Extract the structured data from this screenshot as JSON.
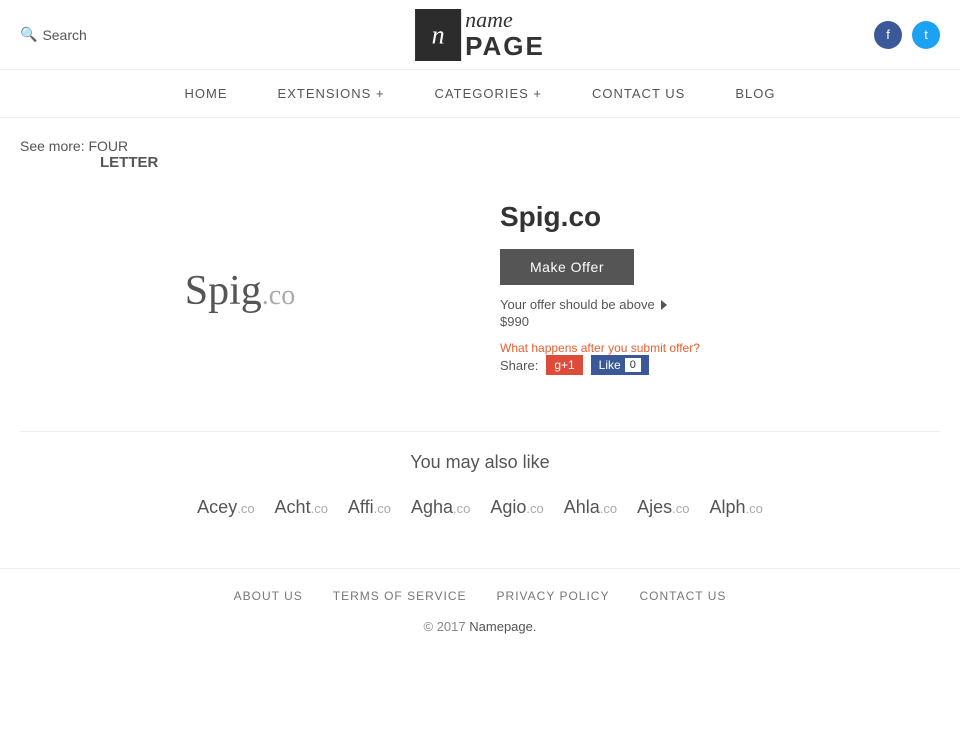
{
  "header": {
    "search_label": "Search",
    "logo_icon_char": "n",
    "logo_name": "name",
    "logo_page": "PAGE",
    "social": {
      "facebook_char": "f",
      "twitter_char": "t"
    }
  },
  "nav": {
    "items": [
      {
        "label": "HOME",
        "key": "home"
      },
      {
        "label": "EXTENSIONS +",
        "key": "extensions"
      },
      {
        "label": "CATEGORIES +",
        "key": "categories"
      },
      {
        "label": "CONTACT US",
        "key": "contact"
      },
      {
        "label": "BLOG",
        "key": "blog"
      }
    ]
  },
  "see_more": {
    "prefix": "See more:",
    "value1": "FOUR",
    "value2": "LETTER"
  },
  "product": {
    "logo_name": "Spig",
    "logo_ext": ".co",
    "title": "Spig.co",
    "make_offer_label": "Make Offer",
    "offer_hint": "Your offer should be above",
    "offer_amount": "$990",
    "what_happens": "What happens after you submit offer?",
    "share_label": "Share:",
    "gplus_label": "g+1",
    "fb_like_label": "Like",
    "fb_count": "0"
  },
  "also_like": {
    "title": "You may also like",
    "domains": [
      {
        "name": "Acey",
        "ext": ".co"
      },
      {
        "name": "Acht",
        "ext": ".co"
      },
      {
        "name": "Affi",
        "ext": ".co"
      },
      {
        "name": "Agha",
        "ext": ".co"
      },
      {
        "name": "Agio",
        "ext": ".co"
      },
      {
        "name": "Ahla",
        "ext": ".co"
      },
      {
        "name": "Ajes",
        "ext": ".co"
      },
      {
        "name": "Alph",
        "ext": ".co"
      }
    ]
  },
  "footer": {
    "links": [
      {
        "label": "ABOUT US",
        "key": "about"
      },
      {
        "label": "TERMS OF SERVICE",
        "key": "terms"
      },
      {
        "label": "PRIVACY POLICY",
        "key": "privacy"
      },
      {
        "label": "CONTACT US",
        "key": "contact"
      }
    ],
    "copyright": "© 2017",
    "brand": "Namepage."
  }
}
